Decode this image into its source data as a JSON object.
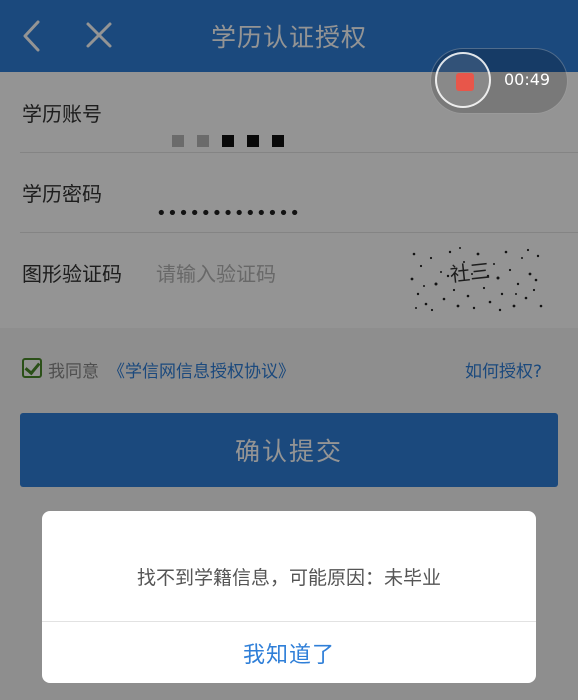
{
  "header": {
    "title": "学历认证授权",
    "back_icon": "chevron-left-icon",
    "close_icon": "close-icon",
    "background": "#2f7fd8"
  },
  "recording": {
    "time": "00:49",
    "stop_icon": "stop-icon",
    "stop_color": "#e8564a"
  },
  "form": {
    "account": {
      "label": "学历账号"
    },
    "password": {
      "label": "学历密码",
      "masked_value": "•••••••••••••"
    },
    "captcha": {
      "label": "图形验证码",
      "placeholder": "请输入验证码",
      "captcha_text": "社三"
    }
  },
  "agreement": {
    "checked": true,
    "prefix": "我同意",
    "link_text": "《学信网信息授权协议》",
    "help_link": "如何授权?"
  },
  "submit": {
    "label": "确认提交"
  },
  "dialog": {
    "message": "找不到学籍信息，可能原因：未毕业",
    "ok_label": "我知道了"
  },
  "colors": {
    "accent": "#2f7fd8",
    "overlay": "rgba(0,0,0,0.42)",
    "check": "#4a8a2a"
  }
}
